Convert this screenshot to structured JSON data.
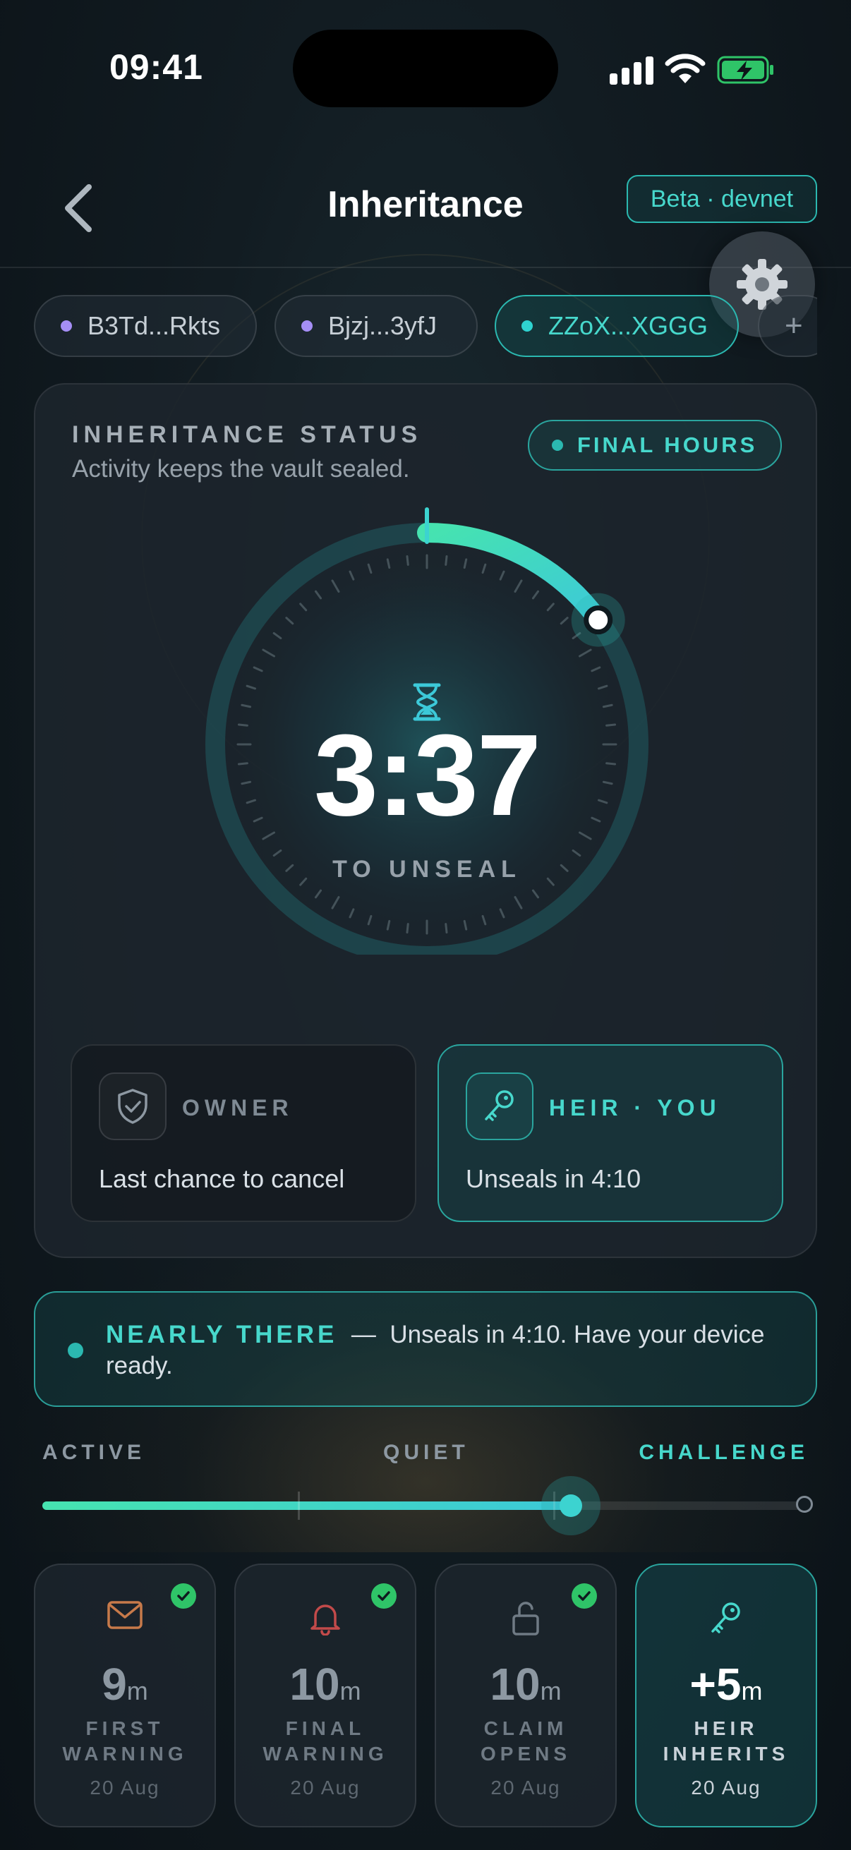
{
  "status_bar": {
    "time": "09:41"
  },
  "nav": {
    "title": "Inheritance",
    "network_badge": "Beta · devnet"
  },
  "wallets": [
    {
      "label": "B3Td...Rkts",
      "color": "#a58ef5",
      "active": false
    },
    {
      "label": "Bjzj...3yfJ",
      "color": "#a58ef5",
      "active": false
    },
    {
      "label": "ZZoX...XGGG",
      "color": "#2fd3d0",
      "active": true
    }
  ],
  "wallet_add_label": "+",
  "status_card": {
    "heading": "INHERITANCE STATUS",
    "subtitle": "Activity keeps the vault sealed.",
    "phase_badge": "FINAL HOURS",
    "countdown": "3:37",
    "countdown_label": "TO UNSEAL",
    "arc_progress": 0.15,
    "owner": {
      "title": "OWNER",
      "description": "Last chance to cancel",
      "icon": "shield-check-icon"
    },
    "heir": {
      "title": "HEIR · YOU",
      "description": "Unseals in 4:10",
      "icon": "key-icon"
    }
  },
  "notice": {
    "headline": "NEARLY THERE",
    "separator": "—",
    "message": "Unseals in 4:10. Have your device ready."
  },
  "phases": {
    "labels": [
      {
        "text": "ACTIVE",
        "color": "#8d98a2"
      },
      {
        "text": "QUIET",
        "color": "#8d98a2"
      },
      {
        "text": "CHALLENGE",
        "color": "#47d8cc"
      }
    ],
    "progress": 0.69
  },
  "timeline": [
    {
      "value": "9",
      "unit": "m",
      "label_line1": "FIRST",
      "label_line2": "WARNING",
      "date": "20 Aug",
      "icon": "envelope-icon",
      "done": true,
      "current": false
    },
    {
      "value": "10",
      "unit": "m",
      "label_line1": "FINAL",
      "label_line2": "WARNING",
      "date": "20 Aug",
      "icon": "bell-icon",
      "done": true,
      "current": false
    },
    {
      "value": "10",
      "unit": "m",
      "label_line1": "CLAIM",
      "label_line2": "OPENS",
      "date": "20 Aug",
      "icon": "unlock-icon",
      "done": true,
      "current": false
    },
    {
      "value": "+5",
      "unit": "m",
      "label_line1": "HEIR",
      "label_line2": "INHERITS",
      "date": "20 Aug",
      "icon": "key-icon",
      "done": false,
      "current": true
    }
  ],
  "colors": {
    "accent": "#47d8cc",
    "success": "#2fc468",
    "arc_start": "#46e3b0",
    "arc_end": "#3cc9d8"
  }
}
